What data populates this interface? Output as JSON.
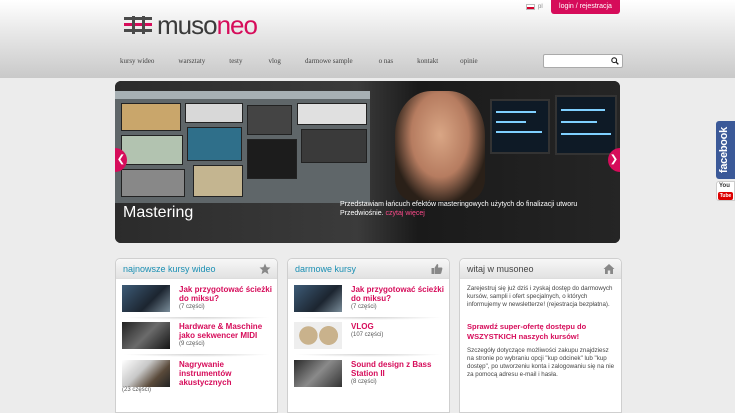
{
  "brand": {
    "logo_part1": "muso",
    "logo_part2": "neo"
  },
  "topbar": {
    "lang_label": "pl",
    "login_label": "login / rejestracja"
  },
  "nav": {
    "items": [
      "kursy wideo",
      "warsztaty",
      "testy",
      "vlog",
      "darmowe sample",
      "o nas",
      "kontakt",
      "opinie"
    ]
  },
  "search": {
    "placeholder": "",
    "value": ""
  },
  "slider": {
    "title": "Mastering",
    "description": "Przedstawiam łańcuch efektów masteringowych użytych do finalizacji utworu Przedwiośnie.",
    "more_link": "czytaj więcej"
  },
  "social": {
    "facebook_label": "facebook",
    "youtube_you": "You",
    "youtube_tube": "Tube"
  },
  "columns": {
    "newest": {
      "title": "najnowsze kursy wideo",
      "items": [
        {
          "title": "Jak przygotować ścieżki do miksu?",
          "count": "(7 części)"
        },
        {
          "title": "Hardware & Maschine jako sekwencer MIDI",
          "count": "(9 części)"
        },
        {
          "title": "Nagrywanie instrumentów akustycznych",
          "count": "(23 części)"
        }
      ]
    },
    "free": {
      "title": "darmowe kursy",
      "items": [
        {
          "title": "Jak przygotować ścieżki do miksu?",
          "count": "(7 części)"
        },
        {
          "title": "VLOG",
          "count": "(107 części)"
        },
        {
          "title": "Sound design z Bass Station II",
          "count": "(8 części)"
        }
      ]
    },
    "welcome": {
      "title": "witaj w musoneo",
      "text1": "Zarejestruj się już dziś i zyskaj dostęp do darmowych kursów, sampli i ofert specjalnych, o których informujemy w newsletterze! (rejestracja bezpłatna).",
      "promo": "Sprawdź super-ofertę dostępu do WSZYSTKICH naszych kursów!",
      "text2": "Szczegóły dotyczące możliwości zakupu znajdziesz na stronie po wybraniu opcji \"kup odcinek\" lub \"kup dostęp\", po utworzeniu konta i zalogowaniu się na nie za pomocą adresu e-mail i hasła."
    }
  },
  "colors": {
    "accent": "#d60c5a",
    "heading_blue": "#1a8fb3",
    "facebook": "#3b5998"
  },
  "icons": {
    "search": "search-icon",
    "star": "star-icon",
    "thumb": "thumbs-up-icon",
    "home": "home-icon"
  }
}
